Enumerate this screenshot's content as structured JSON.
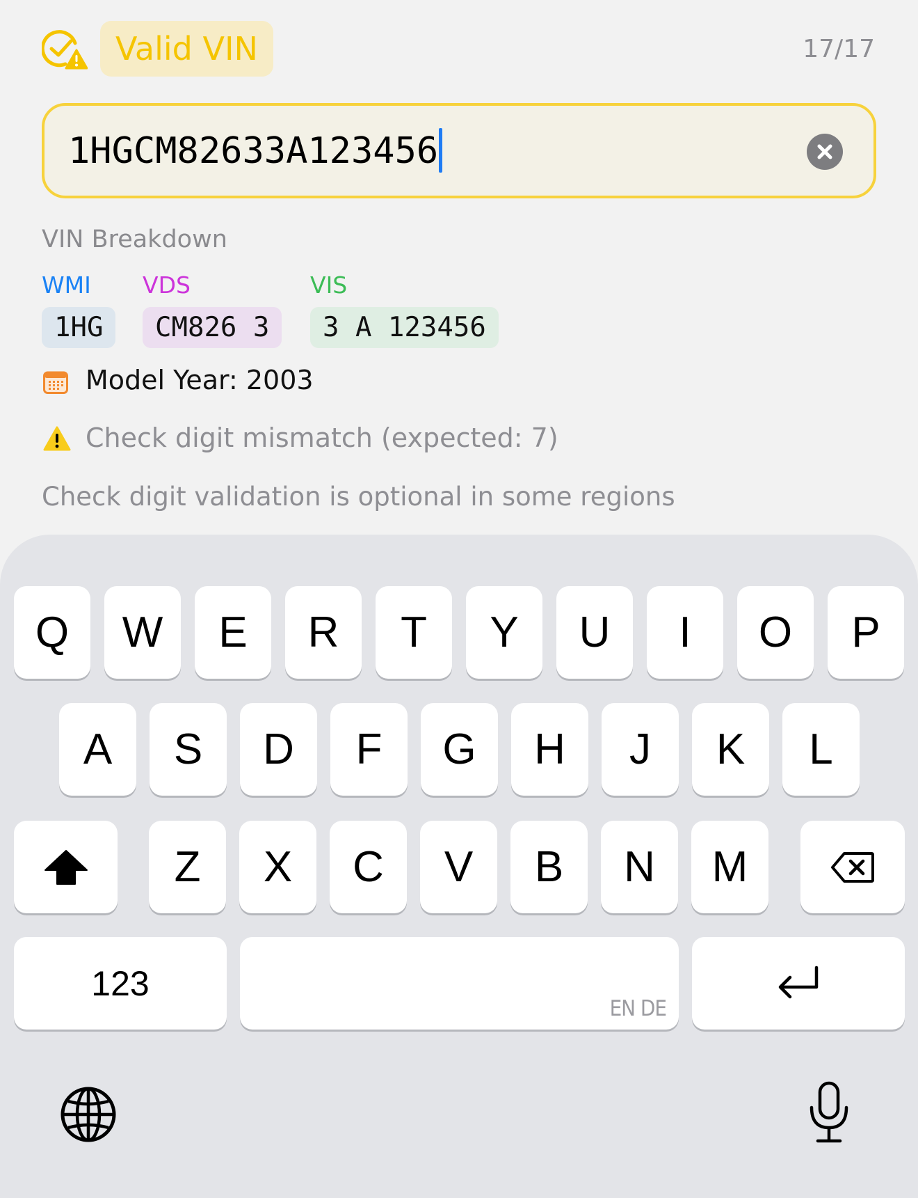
{
  "header": {
    "status_label": "Valid VIN",
    "status_icon": "check-circle-warning-icon",
    "char_count": "17/17"
  },
  "vin_input": {
    "value": "1HGCM82633A123456",
    "clear_icon": "clear-circle-icon"
  },
  "breakdown": {
    "title": "VIN Breakdown",
    "segments": [
      {
        "label": "WMI",
        "value": "1HG",
        "label_color": "#1a82f5",
        "chip_color": "#dde6ee"
      },
      {
        "label": "VDS",
        "value": "CM826 3",
        "label_color": "#cc34da",
        "chip_color": "#ecdef0"
      },
      {
        "label": "VIS",
        "value": "3 A 123456",
        "label_color": "#3cbc56",
        "chip_color": "#dfeee3"
      }
    ],
    "model_year": "Model Year: 2003",
    "warning": "Check digit mismatch (expected: 7)",
    "note": "Check digit validation is optional in some regions"
  },
  "colors": {
    "accent_yellow": "#f5c400",
    "field_border": "#f7d23c",
    "cursor": "#1f7cf4",
    "calendar": "#f28a2e"
  },
  "keyboard": {
    "row1": [
      "Q",
      "W",
      "E",
      "R",
      "T",
      "Y",
      "U",
      "I",
      "O",
      "P"
    ],
    "row2": [
      "A",
      "S",
      "D",
      "F",
      "G",
      "H",
      "J",
      "K",
      "L"
    ],
    "row3": [
      "Z",
      "X",
      "C",
      "V",
      "B",
      "N",
      "M"
    ],
    "numbers_label": "123",
    "space_language": "EN DE",
    "icons": {
      "shift": "shift-arrow-icon",
      "delete": "backspace-icon",
      "return": "return-arrow-icon",
      "globe": "globe-icon",
      "mic": "microphone-icon"
    }
  }
}
